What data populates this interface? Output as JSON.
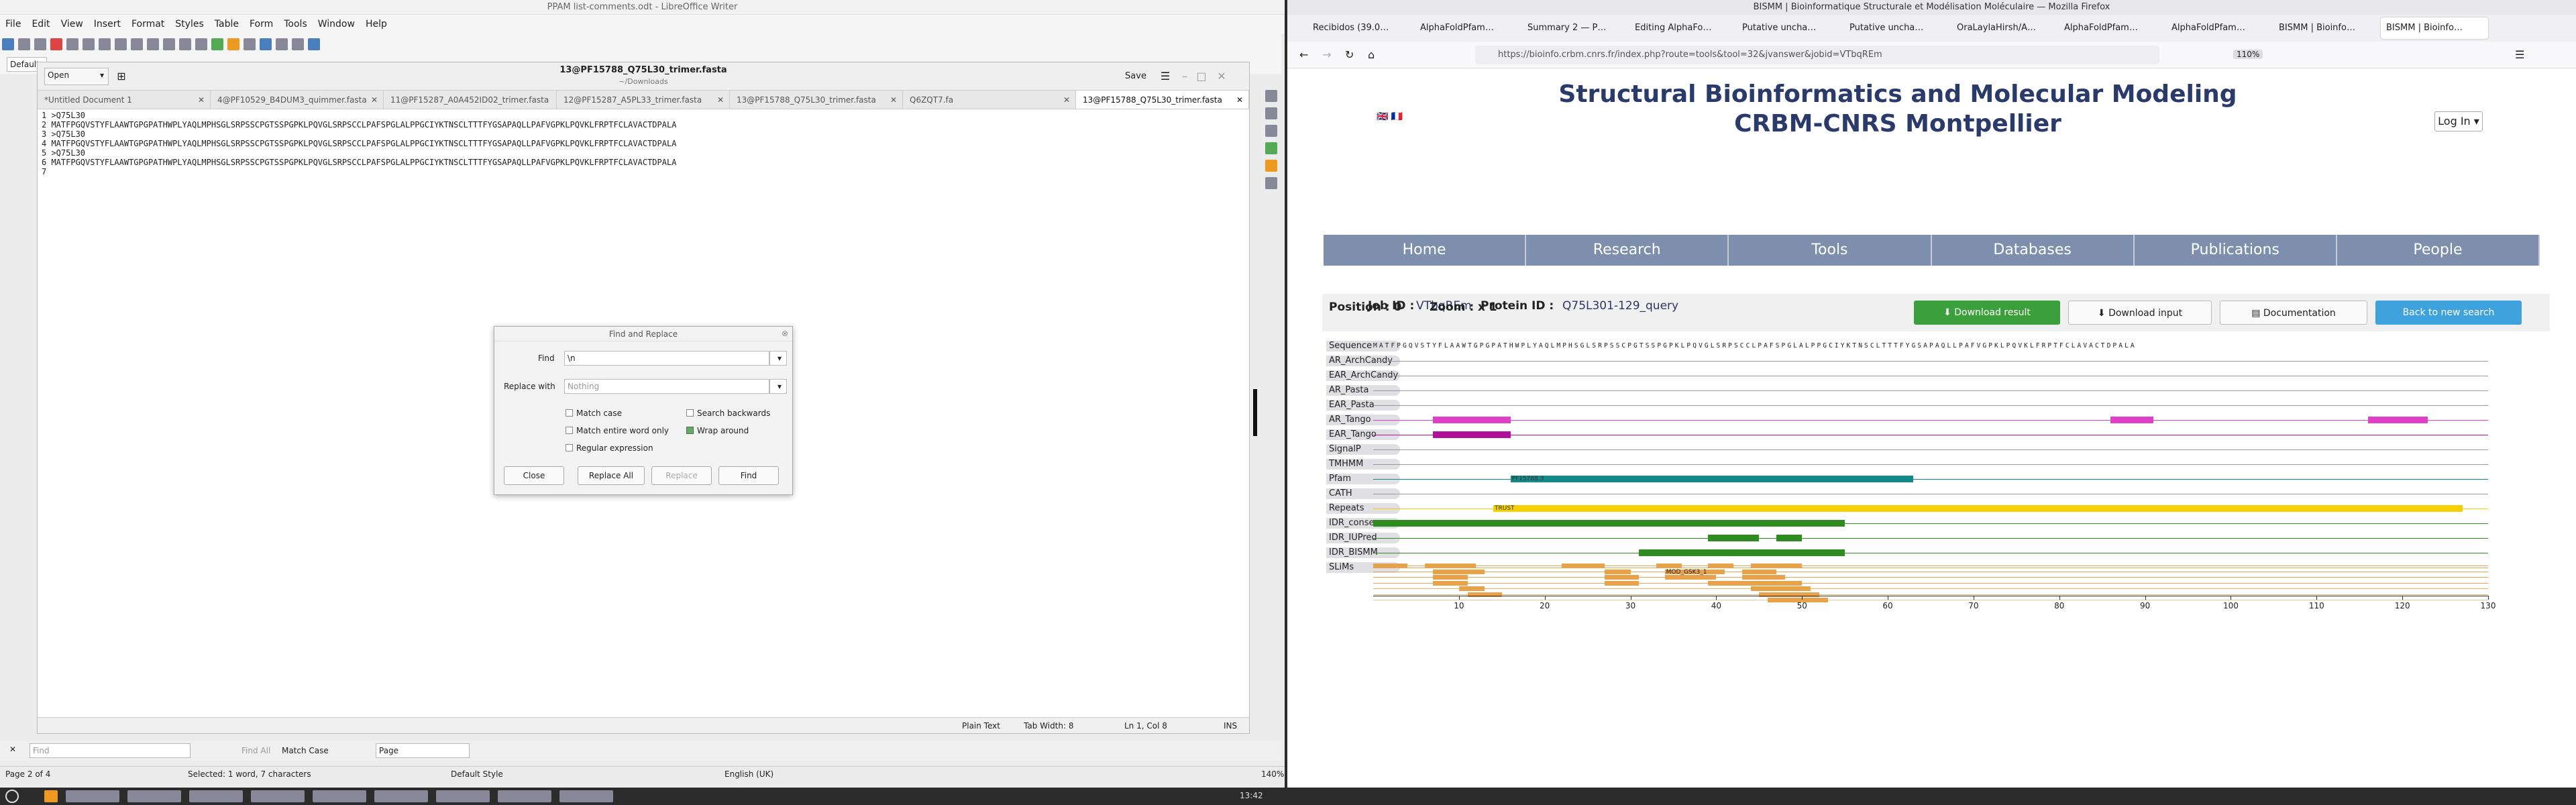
{
  "libreoffice": {
    "title": "PPAM list-comments.odt - LibreOffice Writer",
    "menu": [
      "File",
      "Edit",
      "View",
      "Insert",
      "Format",
      "Styles",
      "Table",
      "Form",
      "Tools",
      "Window",
      "Help"
    ],
    "style_box": "Default",
    "status": {
      "page": "Page 2 of 4",
      "selected": "Selected: 1 word, 7 characters",
      "style": "Default Style",
      "lang": "English (UK)",
      "zoom": "140%"
    },
    "findbar": {
      "placeholder": "Find",
      "find_all": "Find All",
      "match_case": "Match Case",
      "page": "Page"
    }
  },
  "gedit": {
    "title": "13@PF15788_Q75L30_trimer.fasta",
    "subtitle": "~/Downloads",
    "open": "Open",
    "save": "Save",
    "tabs": [
      "*Untitled Document 1",
      "4@PF10529_B4DUM3_quimmer.fasta",
      "11@PF15287_A0A452ID02_trimer.fasta",
      "12@PF15287_A5PL33_trimer.fasta",
      "13@PF15788_Q75L30_trimer.fasta",
      "Q6ZQT7.fa",
      "13@PF15788_Q75L30_trimer.fasta"
    ],
    "lines": [
      "1 >Q75L30",
      "2 MATFPGQVSTYFLAAWTGPGPATHWPLYAQLMPHSGLSRPSSCPGTSSPGPKLPQVGLSRPSCCLPAFSPGLALPPGCIYKTNSCLTTTFYGSAPAQLLPAFVGPKLPQVKLFRPTFCLAVACTDPALA",
      "3 >Q75L30",
      "4 MATFPGQVSTYFLAAWTGPGPATHWPLYAQLMPHSGLSRPSSCPGTSSPGPKLPQVGLSRPSCCLPAFSPGLALPPGCIYKTNSCLTTTFYGSAPAQLLPAFVGPKLPQVKLFRPTFCLAVACTDPALA",
      "5 >Q75L30",
      "6 MATFPGQVSTYFLAAWTGPGPATHWPLYAQLMPHSGLSRPSSCPGTSSPGPKLPQVGLSRPSCCLPAFSPGLALPPGCIYKTNSCLTTTFYGSAPAQLLPAFVGPKLPQVKLFRPTFCLAVACTDPALA",
      "7"
    ],
    "status": {
      "mode": "Plain Text",
      "tab": "Tab Width: 8",
      "pos": "Ln 1, Col 8",
      "ins": "INS"
    }
  },
  "dialog": {
    "title": "Find and Replace",
    "find_label": "Find",
    "find_value": "\\n",
    "replace_label": "Replace with",
    "replace_placeholder": "Nothing",
    "match_case": "Match case",
    "search_backwards": "Search backwards",
    "entire_word": "Match entire word only",
    "wrap": "Wrap around",
    "regex": "Regular expression",
    "buttons": [
      "Close",
      "Replace All",
      "Replace",
      "Find"
    ]
  },
  "firefox": {
    "title": "BISMM | Bioinformatique Structurale et Modélisation Moléculaire — Mozilla Firefox",
    "tabs": [
      "Recibidos (39.0…",
      "AlphaFoldPfam…",
      "Summary 2 — P…",
      "Editing AlphaFo…",
      "Putative uncha…",
      "Putative uncha…",
      "OraLaylaHirsh/A…",
      "AlphaFoldPfam…",
      "AlphaFoldPfam…",
      "BISMM | Bioinfo…",
      "BISMM | Bioinfo…"
    ],
    "url": "https://bioinfo.crbm.cnrs.fr/index.php?route=tools&tool=32&jvanswer&jobid=VTbqREm",
    "zoom": "110%"
  },
  "site": {
    "title1": "Structural Bioinformatics and Molecular Modeling",
    "title2": "CRBM-CNRS Montpellier",
    "login": "Log In",
    "nav": [
      "Home",
      "Research",
      "Tools",
      "Databases",
      "Publications",
      "People"
    ],
    "job_label": "Job ID :",
    "job_id": "VTbqREm",
    "protein_label": "Protein ID :",
    "protein_id": "Q75L301-129_query",
    "btn_download_result": "Download result",
    "btn_download_input": "Download input",
    "btn_doc": "Documentation",
    "btn_back": "Back to new search",
    "position": "Position : 0",
    "zoom": "Zoom : x 1",
    "sequence": "MATFPGQVSTYFLAAWTGPGPATHWPLYAQLMPHSGLSRPSSCPGTSSPGPKLPQVGLSRPSCCLPAFSPGLALPPGCIYKTNSCLTTTFYGSAPAQLLPAFVGPKLPQVKLFRPTFCLAVACTDPALA",
    "tracks": [
      "Sequence",
      "AR_ArchCandy",
      "EAR_ArchCandy",
      "AR_Pasta",
      "EAR_Pasta",
      "AR_Tango",
      "EAR_Tango",
      "SignalP",
      "TMHMM",
      "Pfam",
      "CATH",
      "Repeats",
      "IDR_consens",
      "IDR_IUPred",
      "IDR_BISMM",
      "SLiMs"
    ],
    "pfam_label": "PF15788.3",
    "repeats_label": "TRUST",
    "slim_label": "MOD_GSK3_1",
    "axis": [
      "10",
      "20",
      "30",
      "40",
      "50",
      "60",
      "70",
      "80",
      "90",
      "100",
      "110",
      "120",
      "130"
    ],
    "colors": {
      "tango": "#e040c8",
      "tango_dark": "#b0109a",
      "pfam": "#138a8a",
      "repeats": "#f4d000",
      "idr": "#2e8b1e",
      "slim": "#e8a24a"
    }
  },
  "taskbar": {
    "clock": "13:42"
  }
}
